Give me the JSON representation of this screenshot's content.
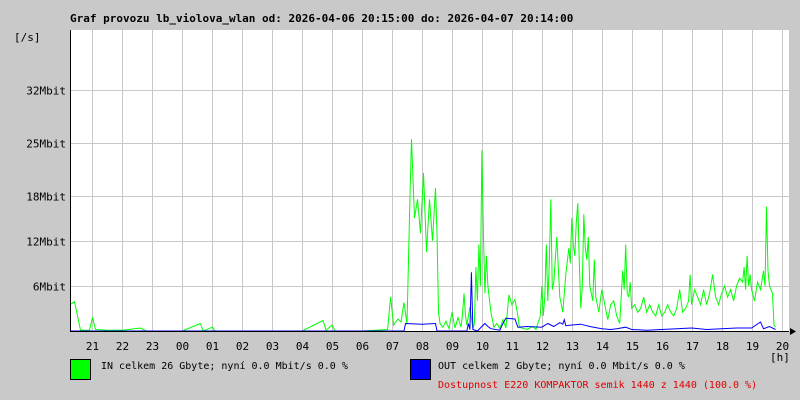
{
  "chart_data": {
    "type": "line",
    "title": "Graf provozu lb_violova_wlan od: 2026-04-06 20:15:00 do: 2026-04-07 20:14:00",
    "ylabel": "[/s]",
    "xlabel": "[h]",
    "x_unit": "hour of day",
    "ylim": [
      0,
      40
    ],
    "y_unit": "Mbit/s",
    "y_ticks": [
      {
        "value": 6,
        "label": "6Mbit"
      },
      {
        "value": 12,
        "label": "12Mbit"
      },
      {
        "value": 18,
        "label": "18Mbit"
      },
      {
        "value": 25,
        "label": "25Mbit"
      },
      {
        "value": 32,
        "label": "32Mbit"
      }
    ],
    "x_ticks": [
      "21",
      "22",
      "23",
      "00",
      "01",
      "02",
      "03",
      "04",
      "05",
      "06",
      "07",
      "08",
      "09",
      "10",
      "11",
      "12",
      "13",
      "14",
      "15",
      "16",
      "17",
      "18",
      "19",
      "20"
    ],
    "grid": true,
    "series": [
      {
        "name": "IN",
        "color": "#00ff00",
        "points": [
          [
            20.25,
            3.5
          ],
          [
            20.4,
            3.9
          ],
          [
            20.5,
            2.0
          ],
          [
            20.6,
            0.1
          ],
          [
            20.9,
            0.1
          ],
          [
            21.0,
            1.8
          ],
          [
            21.1,
            0.2
          ],
          [
            21.5,
            0.1
          ],
          [
            22.0,
            0.1
          ],
          [
            22.6,
            0.4
          ],
          [
            22.8,
            0.0
          ],
          [
            24.0,
            0.0
          ],
          [
            24.6,
            1.0
          ],
          [
            24.7,
            0.0
          ],
          [
            25.0,
            0.5
          ],
          [
            25.1,
            0.0
          ],
          [
            28.0,
            0.0
          ],
          [
            28.7,
            1.4
          ],
          [
            28.8,
            0.1
          ],
          [
            29.0,
            0.8
          ],
          [
            29.1,
            0.0
          ],
          [
            30.0,
            0.0
          ],
          [
            30.85,
            0.2
          ],
          [
            30.95,
            4.5
          ],
          [
            31.05,
            0.8
          ],
          [
            31.2,
            1.6
          ],
          [
            31.3,
            1.2
          ],
          [
            31.4,
            3.8
          ],
          [
            31.5,
            0.9
          ],
          [
            31.6,
            18.0
          ],
          [
            31.65,
            25.5
          ],
          [
            31.75,
            15.0
          ],
          [
            31.85,
            17.5
          ],
          [
            31.95,
            13.0
          ],
          [
            32.05,
            21.0
          ],
          [
            32.15,
            10.5
          ],
          [
            32.25,
            17.5
          ],
          [
            32.35,
            12.0
          ],
          [
            32.45,
            19.0
          ],
          [
            32.5,
            13.0
          ],
          [
            32.55,
            2.5
          ],
          [
            32.6,
            1.0
          ],
          [
            32.7,
            0.5
          ],
          [
            32.8,
            1.3
          ],
          [
            32.9,
            0.3
          ],
          [
            33.0,
            2.5
          ],
          [
            33.1,
            0.4
          ],
          [
            33.2,
            1.8
          ],
          [
            33.3,
            0.5
          ],
          [
            33.35,
            2.2
          ],
          [
            33.4,
            5.0
          ],
          [
            33.45,
            2.0
          ],
          [
            33.5,
            0.8
          ],
          [
            33.6,
            3.2
          ],
          [
            33.7,
            0.3
          ],
          [
            33.75,
            1.0
          ],
          [
            33.8,
            8.5
          ],
          [
            33.85,
            4.0
          ],
          [
            33.9,
            11.5
          ],
          [
            33.95,
            6.0
          ],
          [
            34.0,
            24.0
          ],
          [
            34.05,
            13.0
          ],
          [
            34.1,
            5.0
          ],
          [
            34.15,
            10.0
          ],
          [
            34.2,
            6.0
          ],
          [
            34.3,
            2.5
          ],
          [
            34.4,
            0.5
          ],
          [
            34.5,
            1.0
          ],
          [
            34.6,
            0.3
          ],
          [
            34.7,
            1.5
          ],
          [
            34.8,
            0.4
          ],
          [
            34.9,
            4.8
          ],
          [
            35.0,
            3.5
          ],
          [
            35.1,
            4.2
          ],
          [
            35.2,
            2.0
          ],
          [
            35.25,
            0.5
          ],
          [
            35.5,
            0.2
          ],
          [
            35.7,
            0.6
          ],
          [
            35.8,
            0.2
          ],
          [
            35.95,
            2.0
          ],
          [
            36.0,
            6.0
          ],
          [
            36.05,
            2.0
          ],
          [
            36.1,
            4.5
          ],
          [
            36.15,
            11.5
          ],
          [
            36.2,
            4.0
          ],
          [
            36.25,
            9.0
          ],
          [
            36.3,
            17.5
          ],
          [
            36.35,
            5.5
          ],
          [
            36.4,
            6.5
          ],
          [
            36.5,
            12.5
          ],
          [
            36.6,
            4.5
          ],
          [
            36.7,
            2.5
          ],
          [
            36.8,
            7.5
          ],
          [
            36.9,
            11.0
          ],
          [
            36.95,
            9.0
          ],
          [
            37.0,
            15.0
          ],
          [
            37.05,
            11.5
          ],
          [
            37.1,
            10.0
          ],
          [
            37.15,
            14.5
          ],
          [
            37.2,
            17.0
          ],
          [
            37.25,
            9.0
          ],
          [
            37.3,
            3.0
          ],
          [
            37.35,
            6.0
          ],
          [
            37.4,
            15.5
          ],
          [
            37.45,
            11.0
          ],
          [
            37.5,
            9.5
          ],
          [
            37.55,
            12.5
          ],
          [
            37.6,
            6.0
          ],
          [
            37.7,
            4.0
          ],
          [
            37.75,
            9.5
          ],
          [
            37.8,
            4.5
          ],
          [
            37.9,
            2.5
          ],
          [
            38.0,
            5.5
          ],
          [
            38.1,
            3.5
          ],
          [
            38.2,
            1.5
          ],
          [
            38.3,
            3.5
          ],
          [
            38.4,
            4.0
          ],
          [
            38.5,
            2.0
          ],
          [
            38.6,
            1.0
          ],
          [
            38.7,
            8.0
          ],
          [
            38.75,
            5.5
          ],
          [
            38.8,
            11.5
          ],
          [
            38.85,
            5.0
          ],
          [
            38.9,
            4.5
          ],
          [
            38.95,
            6.5
          ],
          [
            39.0,
            3.0
          ],
          [
            39.1,
            3.5
          ],
          [
            39.2,
            2.5
          ],
          [
            39.3,
            3.0
          ],
          [
            39.4,
            4.5
          ],
          [
            39.5,
            2.5
          ],
          [
            39.6,
            3.5
          ],
          [
            39.7,
            2.5
          ],
          [
            39.8,
            2.0
          ],
          [
            39.9,
            3.5
          ],
          [
            40.0,
            2.0
          ],
          [
            40.1,
            2.5
          ],
          [
            40.2,
            3.5
          ],
          [
            40.3,
            2.5
          ],
          [
            40.4,
            2.0
          ],
          [
            40.5,
            3.0
          ],
          [
            40.6,
            5.5
          ],
          [
            40.7,
            2.5
          ],
          [
            40.8,
            3.0
          ],
          [
            40.9,
            4.0
          ],
          [
            40.95,
            7.5
          ],
          [
            41.0,
            3.5
          ],
          [
            41.1,
            5.5
          ],
          [
            41.2,
            4.5
          ],
          [
            41.3,
            3.5
          ],
          [
            41.4,
            5.5
          ],
          [
            41.5,
            3.5
          ],
          [
            41.6,
            5.0
          ],
          [
            41.7,
            7.5
          ],
          [
            41.8,
            4.5
          ],
          [
            41.9,
            3.5
          ],
          [
            42.0,
            5.0
          ],
          [
            42.1,
            6.0
          ],
          [
            42.2,
            4.5
          ],
          [
            42.3,
            5.5
          ],
          [
            42.4,
            4.0
          ],
          [
            42.5,
            6.0
          ],
          [
            42.6,
            7.0
          ],
          [
            42.7,
            6.5
          ],
          [
            42.75,
            8.5
          ],
          [
            42.8,
            5.5
          ],
          [
            42.85,
            10.0
          ],
          [
            42.9,
            6.0
          ],
          [
            42.95,
            7.5
          ],
          [
            43.0,
            5.5
          ],
          [
            43.1,
            4.0
          ],
          [
            43.2,
            6.5
          ],
          [
            43.3,
            5.5
          ],
          [
            43.4,
            8.0
          ],
          [
            43.45,
            6.0
          ],
          [
            43.5,
            16.5
          ],
          [
            43.55,
            8.0
          ],
          [
            43.6,
            6.0
          ],
          [
            43.7,
            5.0
          ],
          [
            43.75,
            0.8
          ],
          [
            43.8,
            0.5
          ]
        ]
      },
      {
        "name": "OUT",
        "color": "#0000ff",
        "points": [
          [
            20.25,
            0.0
          ],
          [
            31.4,
            0.0
          ],
          [
            31.45,
            1.0
          ],
          [
            32.0,
            0.9
          ],
          [
            32.45,
            1.0
          ],
          [
            32.5,
            0.0
          ],
          [
            33.5,
            0.0
          ],
          [
            33.55,
            1.0
          ],
          [
            33.6,
            0.2
          ],
          [
            33.65,
            7.8
          ],
          [
            33.7,
            0.2
          ],
          [
            33.85,
            0.0
          ],
          [
            34.0,
            0.6
          ],
          [
            34.1,
            1.0
          ],
          [
            34.2,
            0.6
          ],
          [
            34.3,
            0.3
          ],
          [
            34.6,
            0.1
          ],
          [
            34.7,
            1.0
          ],
          [
            34.8,
            1.7
          ],
          [
            35.1,
            1.6
          ],
          [
            35.2,
            0.5
          ],
          [
            35.5,
            0.6
          ],
          [
            36.0,
            0.5
          ],
          [
            36.2,
            1.0
          ],
          [
            36.4,
            0.6
          ],
          [
            36.6,
            1.1
          ],
          [
            36.7,
            0.9
          ],
          [
            36.75,
            1.5
          ],
          [
            36.8,
            0.7
          ],
          [
            37.0,
            0.8
          ],
          [
            37.3,
            0.9
          ],
          [
            37.6,
            0.6
          ],
          [
            38.0,
            0.3
          ],
          [
            38.3,
            0.2
          ],
          [
            38.5,
            0.3
          ],
          [
            38.8,
            0.5
          ],
          [
            39.0,
            0.2
          ],
          [
            39.5,
            0.1
          ],
          [
            40.0,
            0.2
          ],
          [
            40.5,
            0.3
          ],
          [
            41.0,
            0.4
          ],
          [
            41.5,
            0.2
          ],
          [
            42.0,
            0.3
          ],
          [
            42.5,
            0.4
          ],
          [
            43.0,
            0.4
          ],
          [
            43.3,
            1.2
          ],
          [
            43.4,
            0.3
          ],
          [
            43.6,
            0.6
          ],
          [
            43.8,
            0.2
          ]
        ]
      }
    ],
    "legend": [
      {
        "swatch_color": "#00ff00",
        "text": "IN celkem 26 Gbyte; nyní   0.0 Mbit/s 0.0 %"
      },
      {
        "swatch_color": "#0000ff",
        "text": "OUT celkem 2 Gbyte; nyní   0.0 Mbit/s 0.0 %"
      }
    ],
    "availability": "Dostupnost E220 KOMPAKTOR semik 1440 z 1440 (100.0 %)"
  }
}
